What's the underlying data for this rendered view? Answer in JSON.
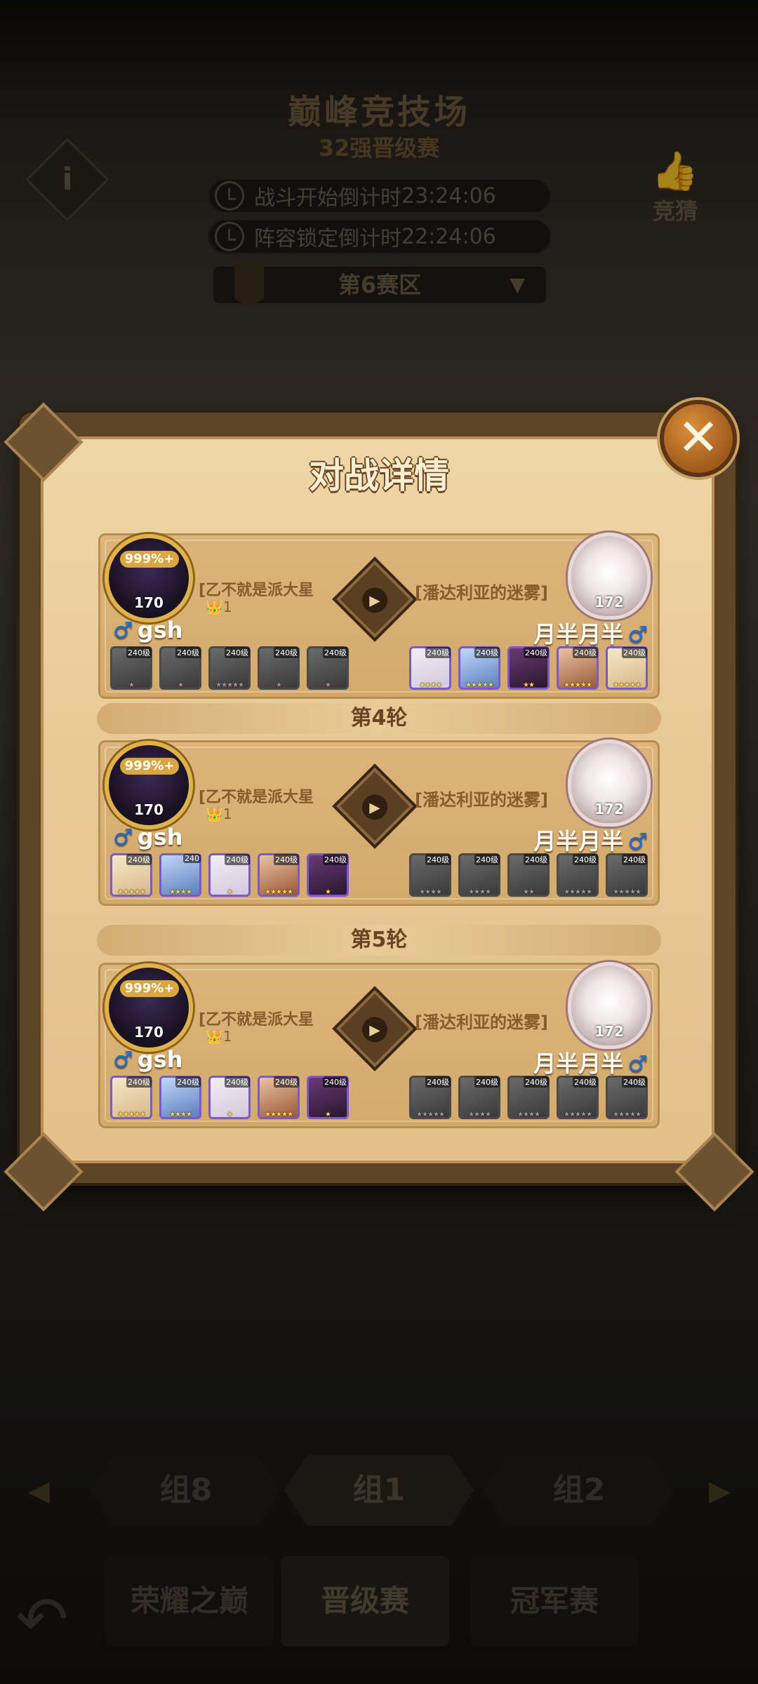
{
  "background": {
    "title": "巅峰竞技场",
    "subtitle": "32强晋级赛",
    "info_label": "i",
    "bet_label": "竞猜",
    "timers": [
      {
        "label": "战斗开始倒计时",
        "value": "23:24:06"
      },
      {
        "label": "阵容锁定倒计时",
        "value": "22:24:06"
      }
    ],
    "zone": "第6赛区",
    "groups": [
      "组8",
      "组1",
      "组2"
    ],
    "tabs": [
      "荣耀之巅",
      "晋级赛",
      "冠军赛"
    ]
  },
  "modal": {
    "title": "对战详情",
    "close_label": "✕",
    "matches": [
      {
        "round_label": "",
        "left": {
          "rank_badge": "999%+",
          "level": "170",
          "guild": "[乙不就是派大星",
          "guild_sub": "1",
          "name": "gsh"
        },
        "right": {
          "level": "172",
          "guild": "[潘达利亚的迷雾]",
          "name": "月半月半"
        },
        "left_heroes": [
          {
            "level": "240级",
            "stars": "★",
            "style": "gray"
          },
          {
            "level": "240级",
            "stars": "★",
            "style": "gray"
          },
          {
            "level": "240级",
            "stars": "★★★★★",
            "style": "gray"
          },
          {
            "level": "240级",
            "stars": "★",
            "style": "gray"
          },
          {
            "level": "240级",
            "stars": "★",
            "style": "gray"
          }
        ],
        "right_heroes": [
          {
            "level": "240级",
            "stars": "★★★★",
            "style": "c3"
          },
          {
            "level": "240级",
            "stars": "★★★★★",
            "style": "c2"
          },
          {
            "level": "240级",
            "stars": "★★",
            "style": "c5"
          },
          {
            "level": "240级",
            "stars": "★★★★★",
            "style": "c4"
          },
          {
            "level": "240级",
            "stars": "★★★★★",
            "style": "c1"
          }
        ]
      },
      {
        "round_label": "第4轮",
        "left": {
          "rank_badge": "999%+",
          "level": "170",
          "guild": "[乙不就是派大星",
          "guild_sub": "1",
          "name": "gsh"
        },
        "right": {
          "level": "172",
          "guild": "[潘达利亚的迷雾]",
          "name": "月半月半"
        },
        "left_heroes": [
          {
            "level": "240级",
            "stars": "★★★★★",
            "style": "c1"
          },
          {
            "level": "240",
            "stars": "★★★★",
            "style": "c2"
          },
          {
            "level": "240级",
            "stars": "★",
            "style": "c3"
          },
          {
            "level": "240级",
            "stars": "★★★★★",
            "style": "c4"
          },
          {
            "level": "240级",
            "stars": "★",
            "style": "c5"
          }
        ],
        "right_heroes": [
          {
            "level": "240级",
            "stars": "★★★★",
            "style": "gray"
          },
          {
            "level": "240级",
            "stars": "★★★★",
            "style": "gray"
          },
          {
            "level": "240级",
            "stars": "★★",
            "style": "gray"
          },
          {
            "level": "240级",
            "stars": "★★★★★",
            "style": "gray"
          },
          {
            "level": "240级",
            "stars": "★★★★★",
            "style": "gray"
          }
        ]
      },
      {
        "round_label": "第5轮",
        "left": {
          "rank_badge": "999%+",
          "level": "170",
          "guild": "[乙不就是派大星",
          "guild_sub": "1",
          "name": "gsh"
        },
        "right": {
          "level": "172",
          "guild": "[潘达利亚的迷雾]",
          "name": "月半月半"
        },
        "left_heroes": [
          {
            "level": "240级",
            "stars": "★★★★★",
            "style": "c1"
          },
          {
            "level": "240级",
            "stars": "★★★★",
            "style": "c2"
          },
          {
            "level": "240级",
            "stars": "★",
            "style": "c3"
          },
          {
            "level": "240级",
            "stars": "★★★★★",
            "style": "c4"
          },
          {
            "level": "240级",
            "stars": "★",
            "style": "c5"
          }
        ],
        "right_heroes": [
          {
            "level": "240级",
            "stars": "★★★★★",
            "style": "gray"
          },
          {
            "level": "240级",
            "stars": "★★★★",
            "style": "gray"
          },
          {
            "level": "240级",
            "stars": "★★★★",
            "style": "gray"
          },
          {
            "level": "240级",
            "stars": "★★★★★",
            "style": "gray"
          },
          {
            "level": "240级",
            "stars": "★★★★★",
            "style": "gray"
          }
        ]
      }
    ]
  }
}
